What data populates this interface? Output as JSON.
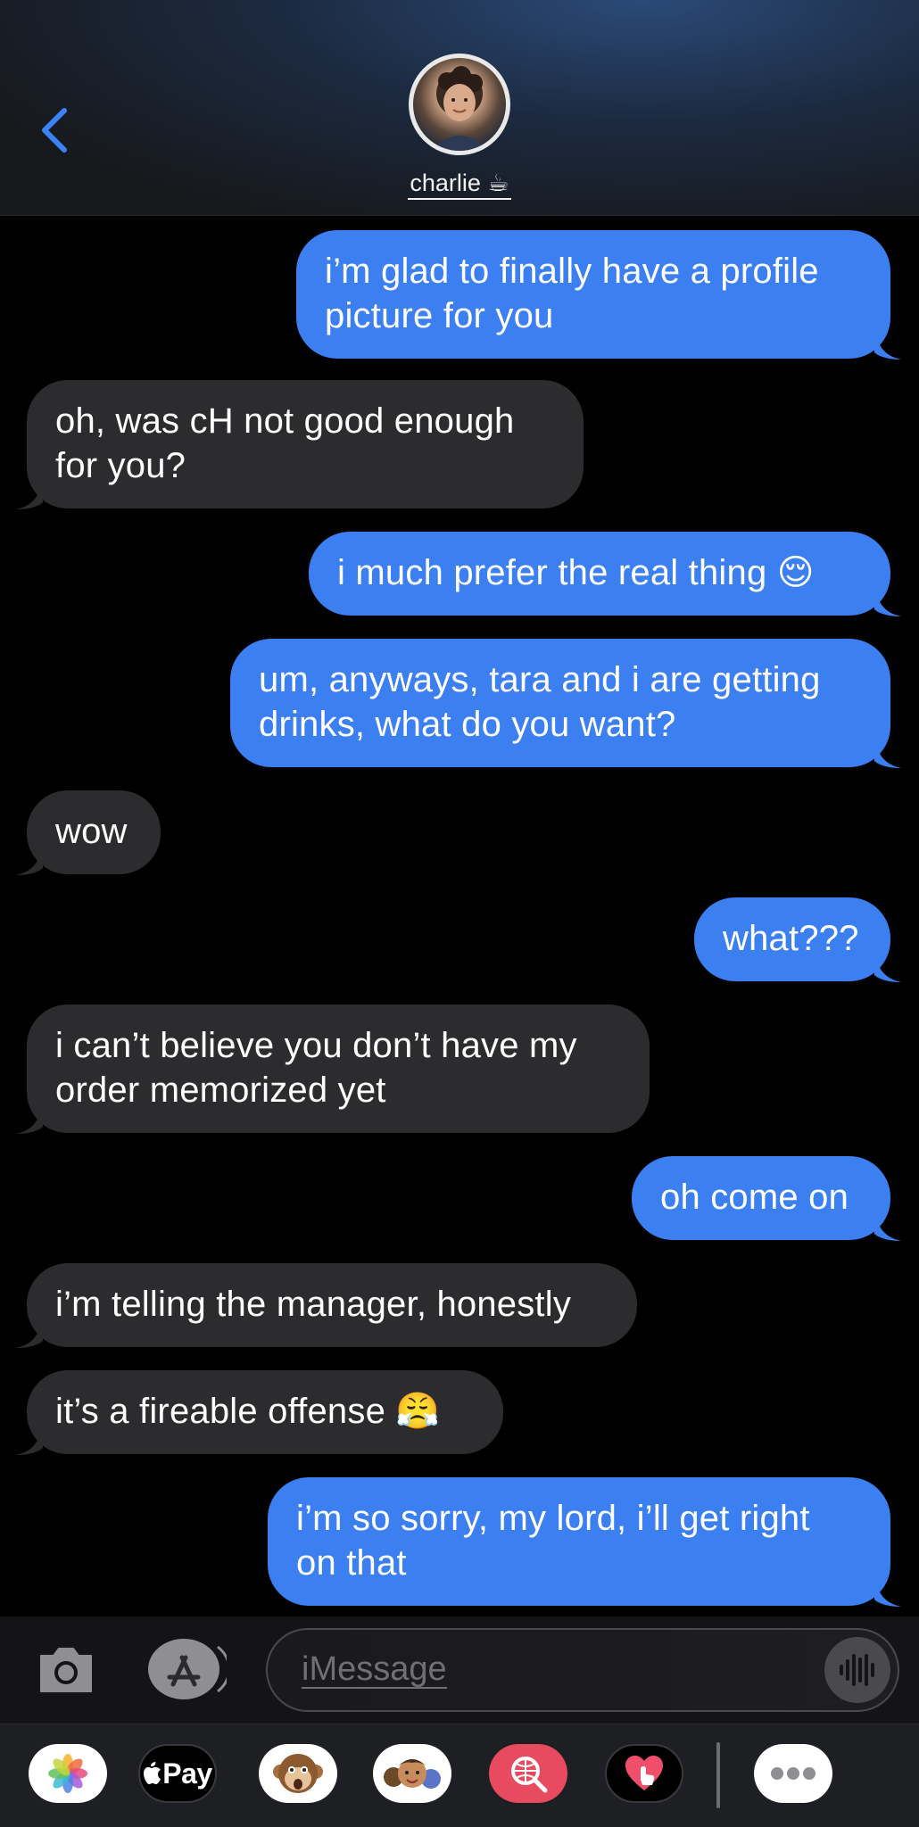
{
  "header": {
    "contact_name": "charlie",
    "contact_emoji": "☕"
  },
  "messages": [
    {
      "direction": "out",
      "lines": [
        "i’m glad to finally have a profile",
        "picture for you"
      ]
    },
    {
      "direction": "in",
      "lines": [
        "oh, was cH not good enough",
        "for you?"
      ]
    },
    {
      "direction": "out",
      "lines": [
        "i much prefer the real thing 😌"
      ]
    },
    {
      "direction": "out",
      "lines": [
        "um, anyways, tara and i are getting",
        "drinks, what do you want?"
      ]
    },
    {
      "direction": "in",
      "lines": [
        "wow"
      ]
    },
    {
      "direction": "out",
      "lines": [
        "what???"
      ]
    },
    {
      "direction": "in",
      "lines": [
        "i can’t believe you don’t have my",
        "order memorized yet"
      ]
    },
    {
      "direction": "out",
      "lines": [
        "oh come on"
      ]
    },
    {
      "direction": "in",
      "lines": [
        "i’m telling the manager, honestly"
      ]
    },
    {
      "direction": "in",
      "lines": [
        "it’s a fireable offense 😤"
      ]
    },
    {
      "direction": "out",
      "lines": [
        "i’m so sorry, my lord, i’ll get right",
        "on that"
      ]
    }
  ],
  "composer": {
    "placeholder": "iMessage"
  },
  "app_drawer": {
    "apple_pay_label": "Pay",
    "apps": [
      "photos-app",
      "apple-pay-app",
      "animoji-app",
      "memoji-app",
      "image-search-app",
      "digital-touch-app",
      "more-apps"
    ]
  },
  "colors": {
    "outgoing_bubble": "#3b7ff0",
    "incoming_bubble": "#2c2c2e",
    "accent": "#3b82f6",
    "background": "#000000"
  }
}
